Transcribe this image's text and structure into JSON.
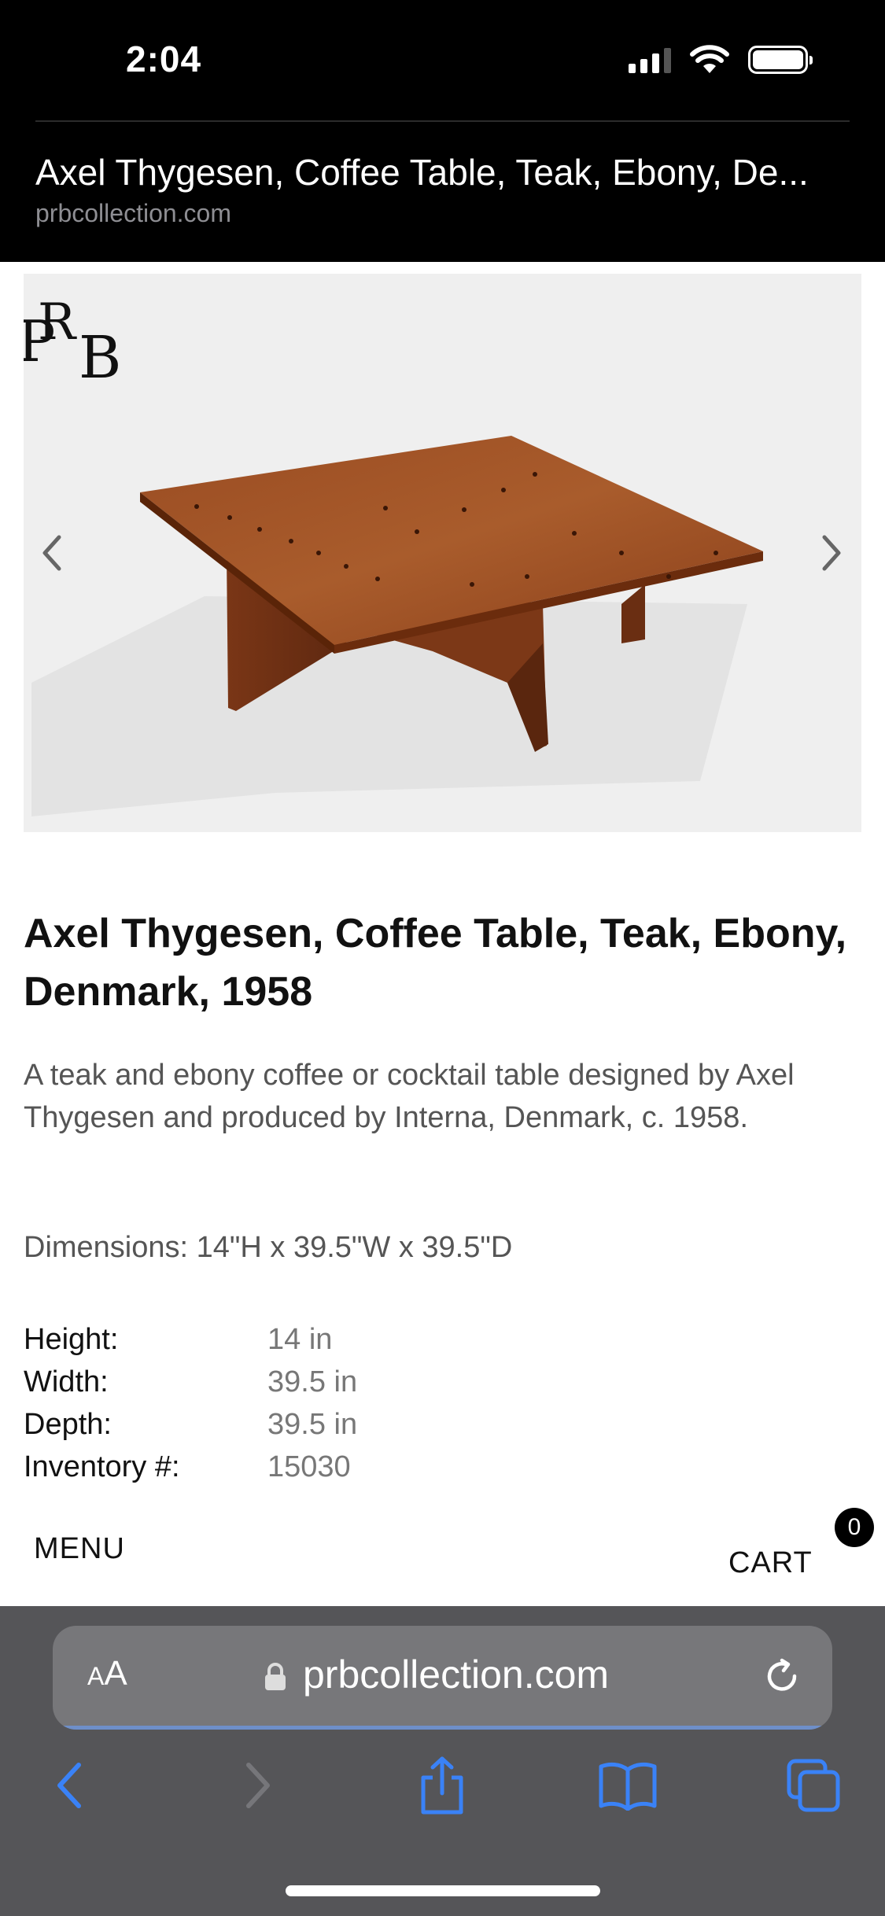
{
  "status_bar": {
    "time": "2:04"
  },
  "browser_header": {
    "title": "Axel Thygesen, Coffee Table, Teak, Ebony, De...",
    "domain": "prbcollection.com"
  },
  "carousel": {
    "logo_letters": {
      "p": "P",
      "r": "R",
      "b": "B"
    },
    "prev_icon": "chevron-left-icon",
    "next_icon": "chevron-right-icon"
  },
  "product": {
    "title": "Axel Thygesen, Coffee Table, Teak, Ebony, Denmark, 1958",
    "description": "A teak and ebony coffee or cocktail table designed by Axel Thygesen and produced by Interna, Denmark, c. 1958.",
    "dimensions": "Dimensions: 14\"H x 39.5\"W x 39.5\"D",
    "specs": [
      {
        "label": "Height:",
        "value": "14 in"
      },
      {
        "label": "Width:",
        "value": "39.5 in"
      },
      {
        "label": "Depth:",
        "value": "39.5 in"
      },
      {
        "label": "Inventory #:",
        "value": "15030"
      }
    ]
  },
  "site_nav": {
    "menu_label": "MENU",
    "cart_label": "CART",
    "cart_count": "0"
  },
  "safari": {
    "aa_small": "A",
    "aa_large": "A",
    "url": "prbcollection.com",
    "toolbar_icons": [
      "back-icon",
      "forward-icon",
      "share-icon",
      "bookmarks-icon",
      "tabs-icon"
    ],
    "accent_color": "#3a82f7"
  }
}
